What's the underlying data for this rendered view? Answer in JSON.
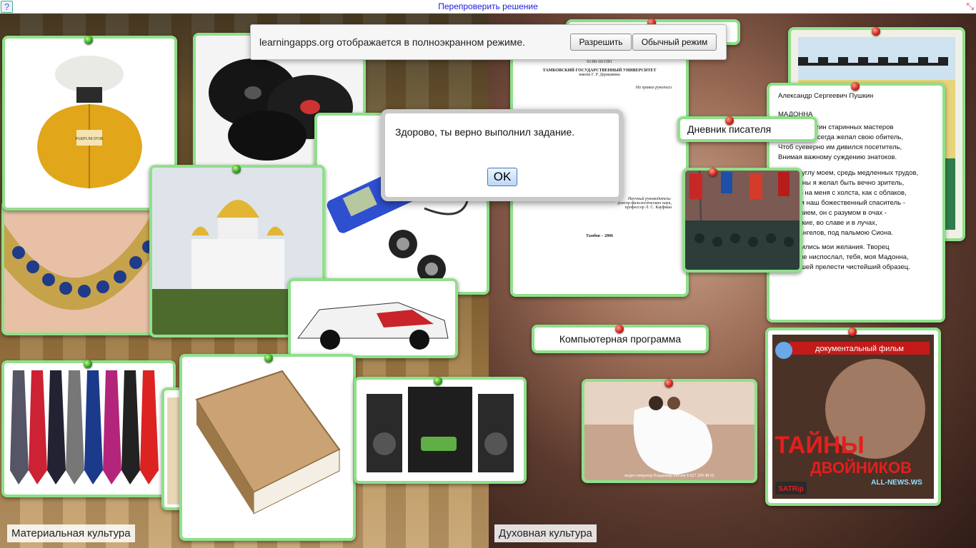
{
  "toolbar": {
    "help_icon": "help-icon",
    "recheck_label": "Перепроверить решение",
    "fullscreen_icon": "fullscreen-exit-icon"
  },
  "notification": {
    "message": "learningapps.org отображается в полноэкранном режиме.",
    "allow_label": "Разрешить",
    "normal_mode_label": "Обычный режим"
  },
  "dialog": {
    "message": "Здорово, ты верно выполнил задание.",
    "ok_label": "OK"
  },
  "categories": {
    "left": "Материальная культура",
    "right": "Духовная культура"
  },
  "cards": {
    "diary_label": "Дневник писателя",
    "program_label": "Компьютерная программа",
    "dvd": {
      "subtitle": "документальный фильм",
      "title_line1": "ТАЙНЫ",
      "title_line2": "ДВОЙНИКОВ",
      "badge": "SATRip",
      "site": "ALL-NEWS.WS"
    },
    "thesis": {
      "code": "61:06-10/1391",
      "university": "ТАМБОВСКИЙ ГОСУДАРСТВЕННЫЙ УНИВЕРСИТЕТ",
      "named": "имени Г. Р. Державина",
      "rights": "На правах рукописи",
      "supervisor_title": "Научный руководитель:",
      "supervisor_degree": "доктор филологических наук,",
      "supervisor_name": "профессор Л. С. Кауфман",
      "city_year": "Тамбов – 2006"
    },
    "poem": {
      "author": "Александр Сергеевич Пушкин",
      "title": "МАДОННА",
      "lines": [
        "…ством картин старинных мастеров",
        "Украсить я всегда желал свою обитель,",
        "Чтоб суеверно им дивился посетитель,",
        "Внимая важному суждению знатоков.",
        "…стом углу моем, средь медленных трудов,",
        "…картины я желал быть вечно зритель,",
        "…: чтоб на меня с холста, как с облаков,",
        "…стая и наш божественный спаситель -",
        "…величием, он с разумом в очах -",
        "…, кроткие, во славе и в лучах,",
        "… без ангелов, под пальмою Сиона.",
        "Исполнились мои желания. Творец",
        "Тебя мне ниспослал, тебя, моя Мадонна,",
        "Чистейшей прелести чистейший образец."
      ]
    },
    "wedding_caption": "видео оператор Владимир Батоев  8 927 269 48 02",
    "perfume_label": "PARFUM D'OR"
  },
  "colors": {
    "card_border": "#8fe08a",
    "pin_green": "#2f9a1c",
    "pin_red": "#c8231a",
    "link": "#1a1adf"
  }
}
